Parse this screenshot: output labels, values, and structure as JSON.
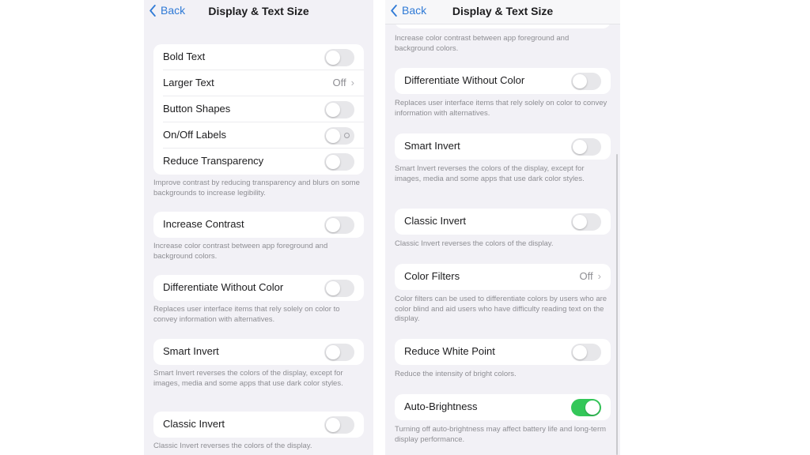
{
  "screens": [
    {
      "nav": {
        "back_label": "Back",
        "title": "Display & Text Size"
      },
      "groups": [
        {
          "rows": [
            {
              "label": "Bold Text",
              "type": "toggle",
              "on": false
            },
            {
              "label": "Larger Text",
              "type": "link",
              "value": "Off"
            },
            {
              "label": "Button Shapes",
              "type": "toggle",
              "on": false
            },
            {
              "label": "On/Off Labels",
              "type": "toggle",
              "on": false
            },
            {
              "label": "Reduce Transparency",
              "type": "toggle",
              "on": false
            }
          ],
          "footer": "Improve contrast by reducing transparency and blurs on some backgrounds to increase legibility."
        },
        {
          "rows": [
            {
              "label": "Increase Contrast",
              "type": "toggle",
              "on": false
            }
          ],
          "footer": "Increase color contrast between app foreground and background colors."
        },
        {
          "rows": [
            {
              "label": "Differentiate Without Color",
              "type": "toggle",
              "on": false
            }
          ],
          "footer": "Replaces user interface items that rely solely on color to convey information with alternatives."
        },
        {
          "rows": [
            {
              "label": "Smart Invert",
              "type": "toggle",
              "on": false
            }
          ],
          "footer": "Smart Invert reverses the colors of the display, except for images, media and some apps that use dark color styles."
        },
        {
          "rows": [
            {
              "label": "Classic Invert",
              "type": "toggle",
              "on": false
            }
          ],
          "footer": "Classic Invert reverses the colors of the display."
        }
      ]
    },
    {
      "nav": {
        "back_label": "Back",
        "title": "Display & Text Size"
      },
      "groups": [
        {
          "rows": [],
          "footer": "Increase color contrast between app foreground and background colors."
        },
        {
          "rows": [
            {
              "label": "Differentiate Without Color",
              "type": "toggle",
              "on": false
            }
          ],
          "footer": "Replaces user interface items that rely solely on color to convey information with alternatives."
        },
        {
          "rows": [
            {
              "label": "Smart Invert",
              "type": "toggle",
              "on": false
            }
          ],
          "footer": "Smart Invert reverses the colors of the display, except for images, media and some apps that use dark color styles."
        },
        {
          "rows": [
            {
              "label": "Classic Invert",
              "type": "toggle",
              "on": false
            }
          ],
          "footer": "Classic Invert reverses the colors of the display."
        },
        {
          "rows": [
            {
              "label": "Color Filters",
              "type": "link",
              "value": "Off"
            }
          ],
          "footer": "Color filters can be used to differentiate colors by users who are color blind and aid users who have difficulty reading text on the display."
        },
        {
          "rows": [
            {
              "label": "Reduce White Point",
              "type": "toggle",
              "on": false
            }
          ],
          "footer": "Reduce the intensity of bright colors."
        },
        {
          "rows": [
            {
              "label": "Auto-Brightness",
              "type": "toggle",
              "on": true
            }
          ],
          "footer": "Turning off auto-brightness may affect battery life and long-term display performance."
        }
      ]
    }
  ],
  "colors": {
    "accent": "#2f7ad6",
    "toggle_on": "#34c759",
    "background": "#f2f1f6"
  }
}
